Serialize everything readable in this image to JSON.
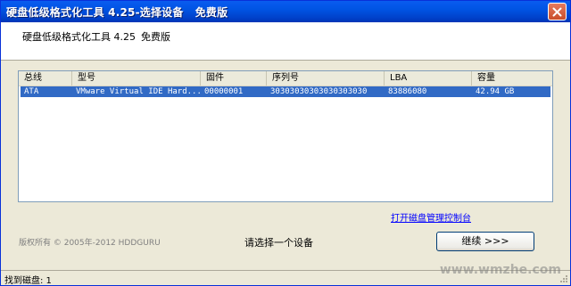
{
  "window": {
    "title": "硬盘低级格式化工具 4.25-选择设备   免费版"
  },
  "header": {
    "app_title": "硬盘低级格式化工具 4.25",
    "edition": "免费版"
  },
  "device_table": {
    "columns": [
      "总线",
      "型号",
      "固件",
      "序列号",
      "LBA",
      "容量"
    ],
    "rows": [
      {
        "bus": "ATA",
        "model": "VMware Virtual IDE Hard...",
        "firmware": "00000001",
        "serial": "30303030303030303030",
        "lba": "83886080",
        "capacity": "42.94 GB"
      }
    ]
  },
  "footer": {
    "manage_link": "打开磁盘管理控制台",
    "copyright": "版权所有 © 2005年-2012 HDDGURU",
    "status_message": "请选择一个设备",
    "continue_label": "继续 >>>"
  },
  "statusbar": {
    "text": "找到磁盘: 1"
  },
  "watermark": "www.wmzhe.com",
  "colors": {
    "title_bar": "#0054e3",
    "selection": "#316ac5",
    "link": "#0000ff"
  }
}
